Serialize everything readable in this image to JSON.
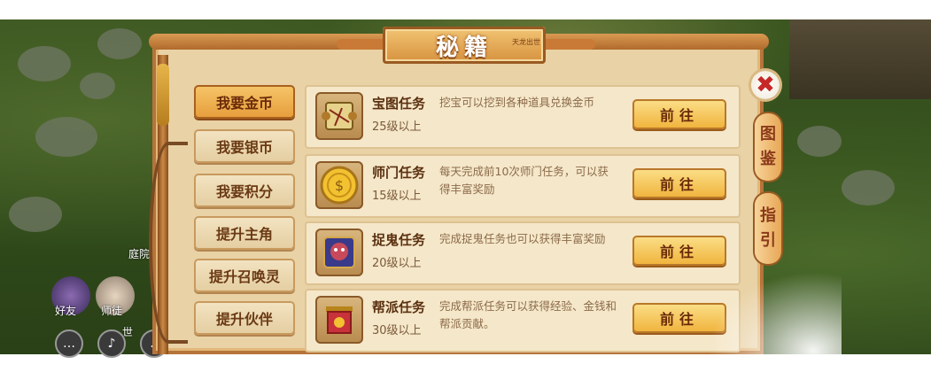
{
  "title": "秘籍",
  "title_seal": "天龙出世",
  "side_tabs": [
    "图鉴",
    "指引"
  ],
  "menu": [
    {
      "label": "我要金币",
      "active": true
    },
    {
      "label": "我要银币",
      "active": false
    },
    {
      "label": "我要积分",
      "active": false
    },
    {
      "label": "提升主角",
      "active": false
    },
    {
      "label": "提升召唤灵",
      "active": false
    },
    {
      "label": "提升伙伴",
      "active": false
    }
  ],
  "tasks": [
    {
      "name": "宝图任务",
      "level": "25级以上",
      "desc": "挖宝可以挖到各种道具兑换金币",
      "button": "前往",
      "icon": "treasure-map-icon"
    },
    {
      "name": "师门任务",
      "level": "15级以上",
      "desc": "每天完成前10次师门任务，可以获得丰富奖励",
      "button": "前往",
      "icon": "gold-coin-icon"
    },
    {
      "name": "捉鬼任务",
      "level": "20级以上",
      "desc": "完成捉鬼任务也可以获得丰富奖励",
      "button": "前往",
      "icon": "ghost-icon"
    },
    {
      "name": "帮派任务",
      "level": "30级以上",
      "desc": "完成帮派任务可以获得经验、金钱和帮派贡献。",
      "button": "前往",
      "icon": "guild-banner-icon"
    }
  ],
  "hud": {
    "friends_label": "好友",
    "master_label": "师徒",
    "world_label": "世",
    "place_label": "庭院"
  },
  "colors": {
    "accent": "#f0b23a",
    "frame": "#e9d2a6",
    "close": "#c62828"
  }
}
